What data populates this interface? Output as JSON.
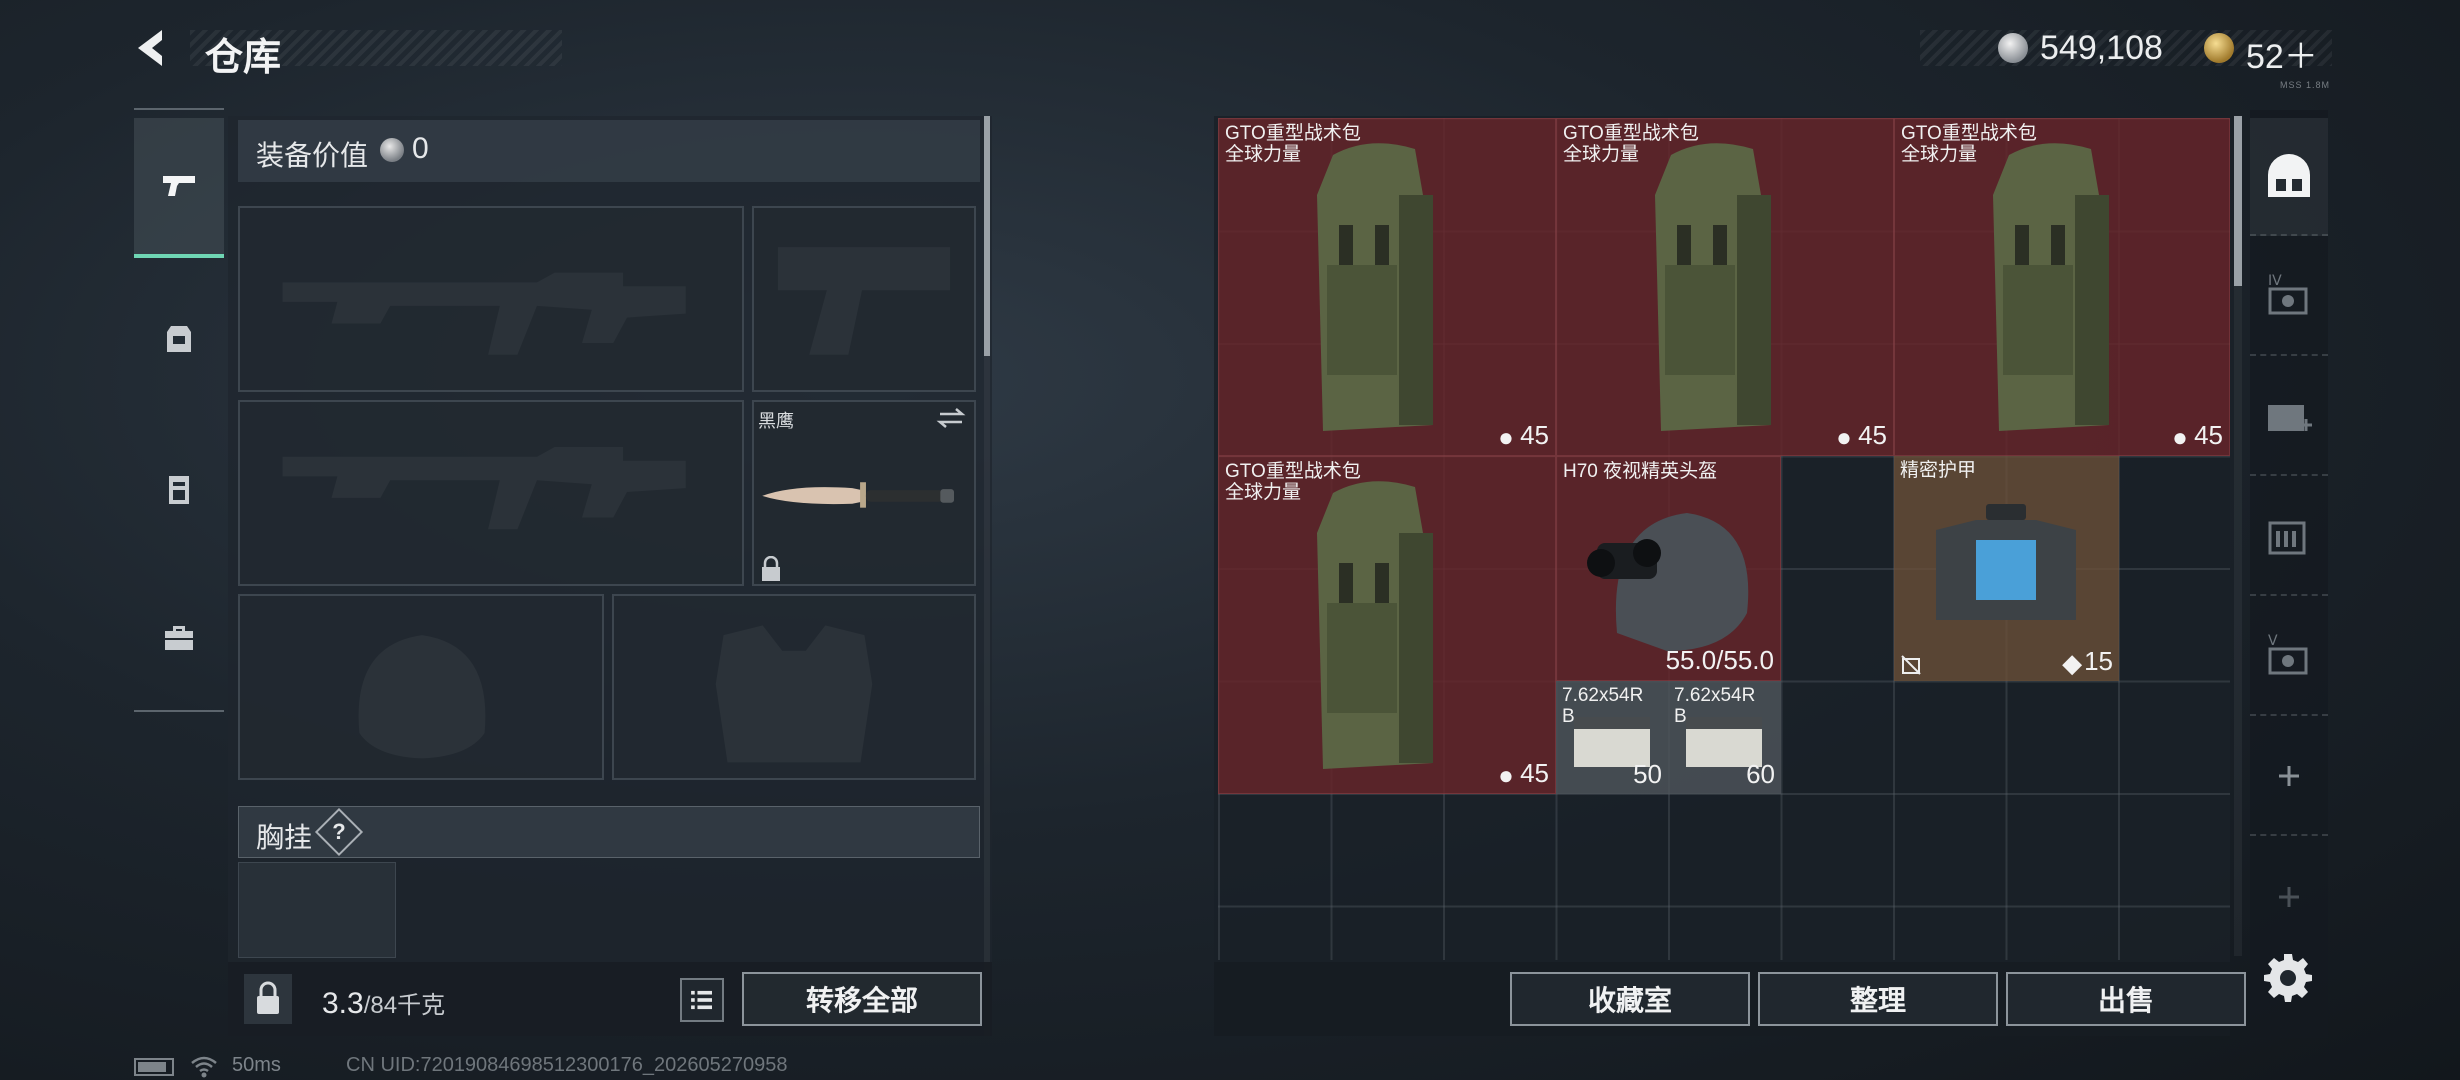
{
  "header": {
    "title": "仓库",
    "currency_silver": "549,108",
    "currency_gold": "52＋",
    "version_tag": "MSS 1.8M"
  },
  "sidebar": {
    "items": [
      {
        "icon": "pistol-icon",
        "active": true
      },
      {
        "icon": "backpack-icon",
        "active": false
      },
      {
        "icon": "clipboard-icon",
        "active": false
      },
      {
        "icon": "toolbox-icon",
        "active": false
      }
    ]
  },
  "loadout": {
    "equip_value_label": "装备价值",
    "equip_value": "0",
    "knife_name": "黑鹰",
    "chest_rig_label": "胸挂",
    "help_symbol": "?",
    "weight_current": "3.3",
    "weight_max": "/84千克",
    "transfer_all": "转移全部"
  },
  "stash": {
    "items": [
      {
        "name": "GTO重型战术包\n全球力量",
        "qty": "45"
      },
      {
        "name": "GTO重型战术包\n全球力量",
        "qty": "45"
      },
      {
        "name": "GTO重型战术包\n全球力量",
        "qty": "45"
      },
      {
        "name": "GTO重型战术包\n全球力量",
        "qty": "45"
      },
      {
        "name": "H70 夜视精英头盔",
        "qty": "55.0/55.0"
      },
      {
        "name": "精密护甲",
        "qty": "15"
      },
      {
        "name": "7.62x54R\nB",
        "qty": "50"
      },
      {
        "name": "7.62x54R\nB",
        "qty": "60"
      }
    ],
    "buttons": {
      "collection": "收藏室",
      "organize": "整理",
      "sell": "出售"
    }
  },
  "right_rail": {
    "items": [
      "stash-icon",
      "case-iv-icon",
      "medkit-case-icon",
      "ammo-case-icon",
      "case-v-icon",
      "plus-icon",
      "plus-icon"
    ]
  },
  "status": {
    "ping": "50ms",
    "uid": "CN UID:72019084698512300176_202605270958"
  },
  "colors": {
    "accent": "#6fd6b4",
    "item_red": "#68242a",
    "item_brown": "#6c5038"
  }
}
